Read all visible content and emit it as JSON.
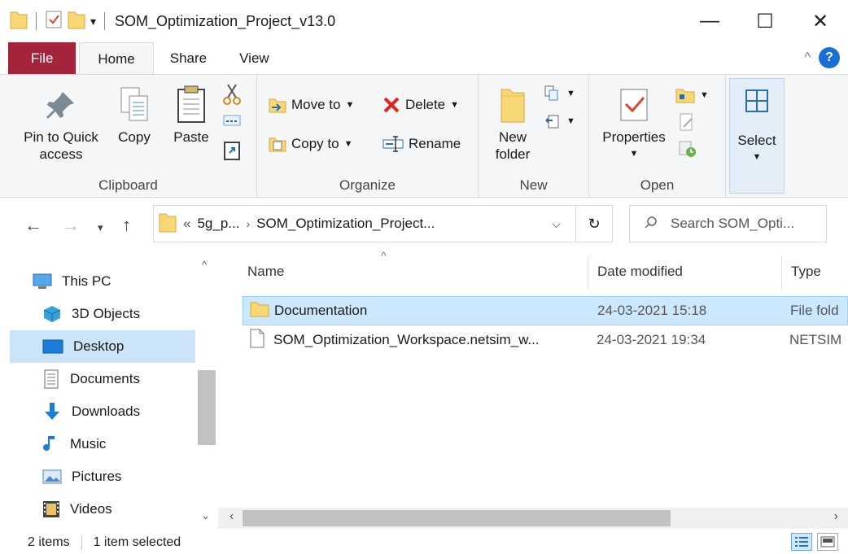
{
  "window": {
    "title": "SOM_Optimization_Project_v13.0",
    "minimize": "—",
    "maximize": "☐",
    "close": "✕"
  },
  "ribbon_tabs": [
    {
      "label": "File"
    },
    {
      "label": "Home"
    },
    {
      "label": "Share"
    },
    {
      "label": "View"
    }
  ],
  "ribbon": {
    "clipboard": {
      "pin_label_1": "Pin to Quick",
      "pin_label_2": "access",
      "copy": "Copy",
      "paste": "Paste",
      "group": "Clipboard"
    },
    "organize": {
      "move_to": "Move to",
      "copy_to": "Copy to",
      "delete": "Delete",
      "rename": "Rename",
      "group": "Organize"
    },
    "new": {
      "new_folder_1": "New",
      "new_folder_2": "folder",
      "group": "New"
    },
    "open": {
      "properties": "Properties",
      "group": "Open"
    },
    "select": {
      "label": "Select"
    }
  },
  "address": {
    "overflow": "«",
    "segment1": "5g_p...",
    "segment2": "SOM_Optimization_Project...",
    "search_placeholder": "Search SOM_Opti..."
  },
  "nav_items": [
    {
      "label": "This PC"
    },
    {
      "label": "3D Objects"
    },
    {
      "label": "Desktop"
    },
    {
      "label": "Documents"
    },
    {
      "label": "Downloads"
    },
    {
      "label": "Music"
    },
    {
      "label": "Pictures"
    },
    {
      "label": "Videos"
    }
  ],
  "columns": {
    "name": "Name",
    "date": "Date modified",
    "type": "Type"
  },
  "files": [
    {
      "name": "Documentation",
      "date": "24-03-2021 15:18",
      "type": "File fold"
    },
    {
      "name": "SOM_Optimization_Workspace.netsim_w...",
      "date": "24-03-2021 19:34",
      "type": "NETSIM"
    }
  ],
  "status": {
    "items": "2 items",
    "selected": "1 item selected"
  },
  "colors": {
    "file_tab": "#a4243b",
    "selection": "#cce8ff",
    "folder": "#f8d775"
  }
}
